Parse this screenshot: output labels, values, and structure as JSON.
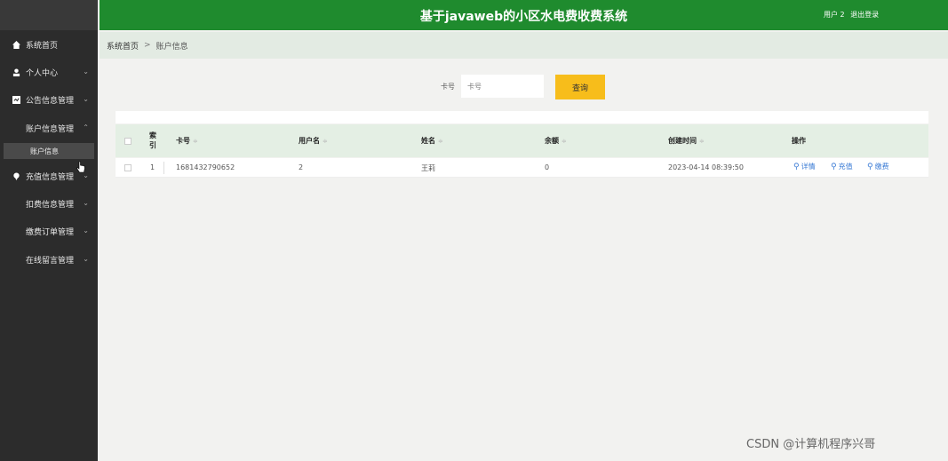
{
  "header": {
    "title": "基于javaweb的小区水电费收费系统",
    "user": "用户 2",
    "logout": "退出登录"
  },
  "sidebar": {
    "items": [
      {
        "label": "系统首页",
        "icon": "home-icon"
      },
      {
        "label": "个人中心",
        "icon": "user-icon"
      },
      {
        "label": "公告信息管理",
        "icon": "notice-icon"
      },
      {
        "label": "账户信息管理",
        "icon": "grid-icon"
      },
      {
        "label": "充值信息管理",
        "icon": "pin-icon"
      },
      {
        "label": "扣费信息管理",
        "icon": "grid-icon"
      },
      {
        "label": "缴费订单管理",
        "icon": "grid-icon"
      },
      {
        "label": "在线留言管理",
        "icon": "grid-icon"
      }
    ],
    "sub_item": "账户信息"
  },
  "breadcrumb": {
    "home": "系统首页",
    "separator": ">",
    "current": "账户信息"
  },
  "search": {
    "label": "卡号",
    "placeholder": "卡号",
    "button": "查询"
  },
  "table": {
    "headers": {
      "index": "索引",
      "card": "卡号",
      "username": "用户名",
      "name": "姓名",
      "balance": "余额",
      "created": "创建时间",
      "actions": "操作"
    },
    "rows": [
      {
        "index": "1",
        "card": "1681432790652",
        "username": "2",
        "name": "王莉",
        "balance": "0",
        "created": "2023-04-14 08:39:50"
      }
    ],
    "row_actions": [
      "详情",
      "充值",
      "缴费"
    ]
  },
  "watermark": "CSDN @计算机程序兴哥",
  "colors": {
    "header": "#1f8b2e",
    "sidebar": "#2c2c2c",
    "search_button": "#f7bd1b",
    "action_link": "#3a7bd5"
  }
}
